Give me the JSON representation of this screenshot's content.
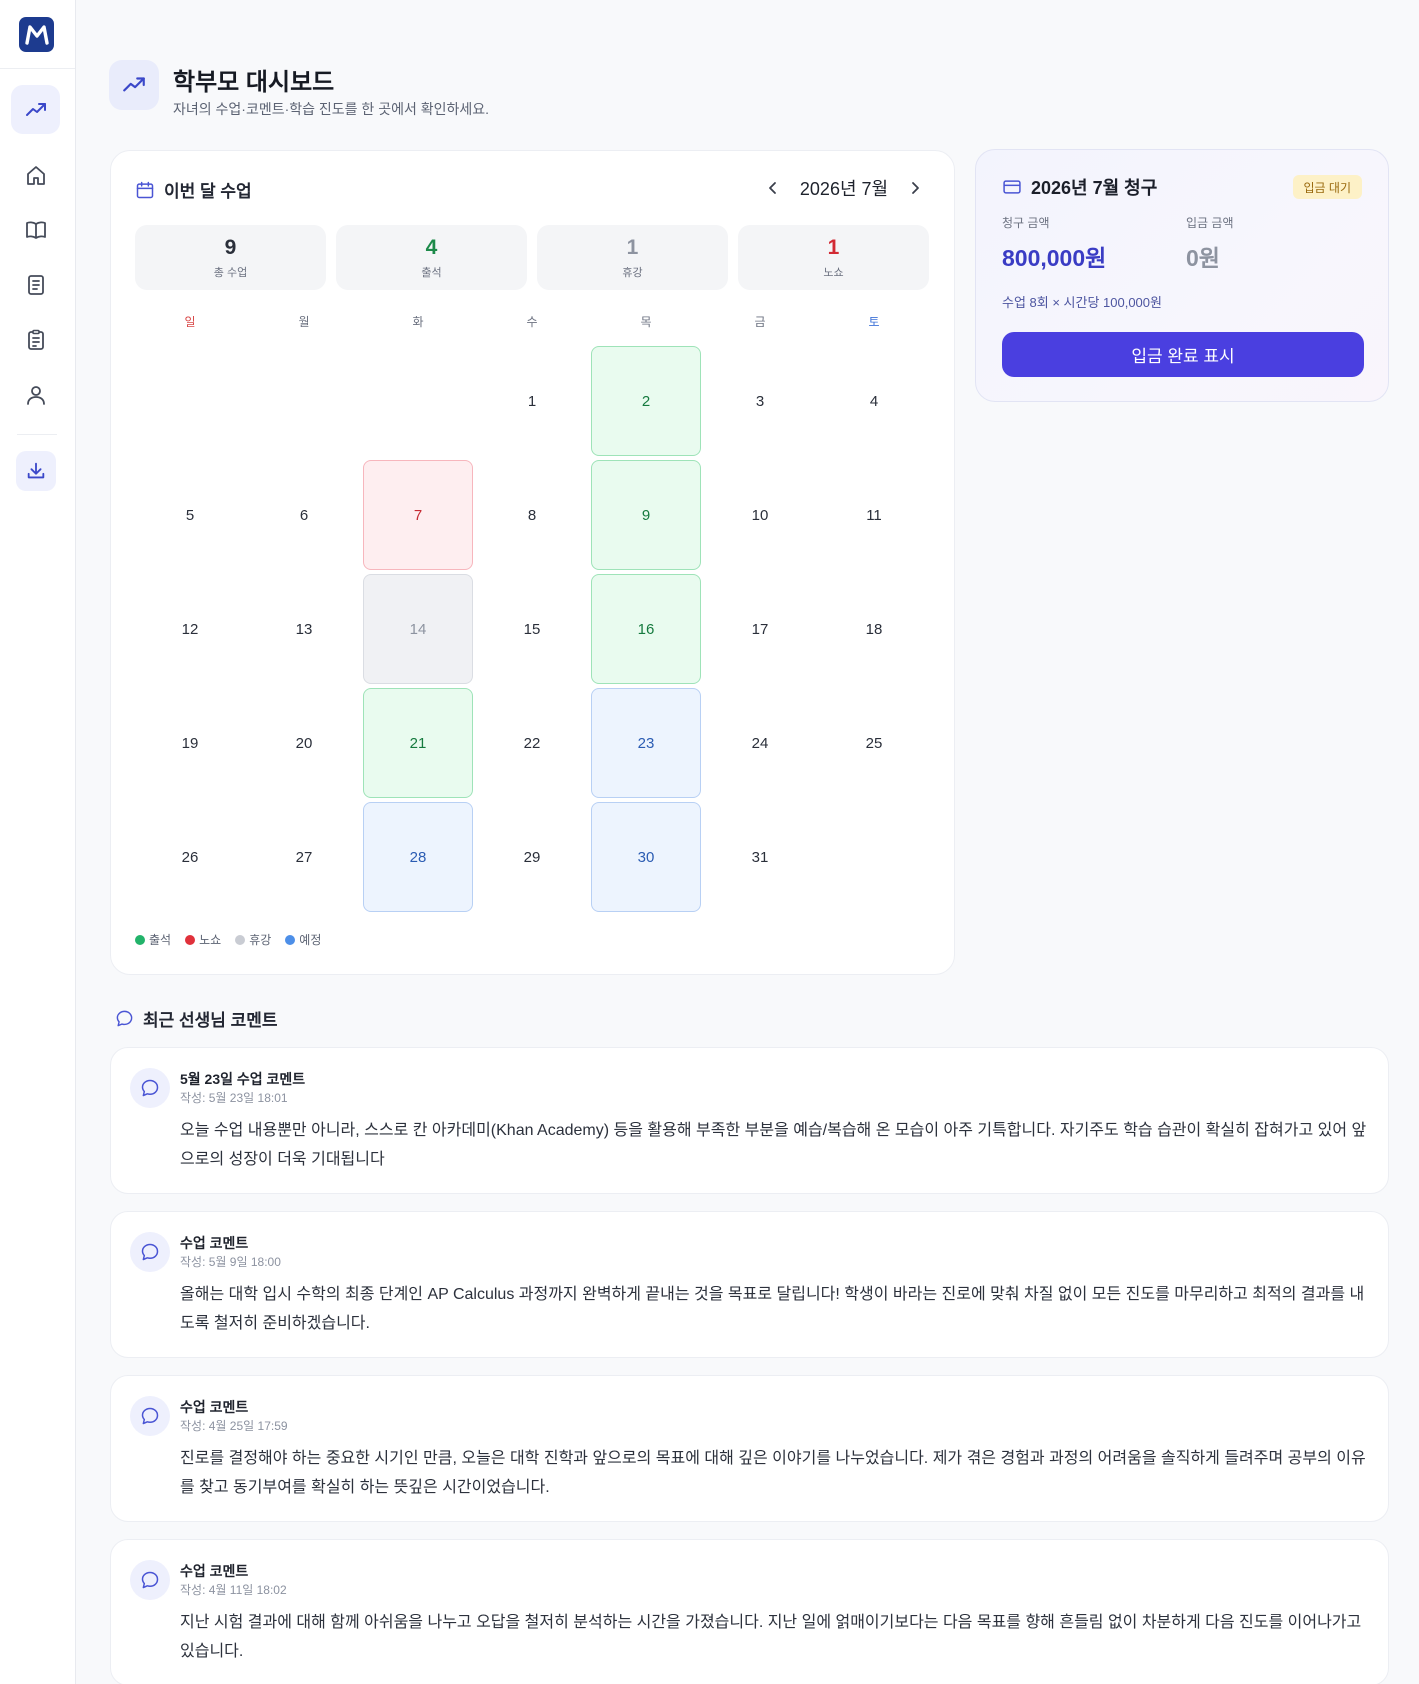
{
  "app": {
    "logo_letter": "M"
  },
  "colors": {
    "accent": "#4a3fe0",
    "attend": "#22b36a",
    "noshow": "#e0313b",
    "break": "#c9ccd3",
    "scheduled": "#4d8fe8"
  },
  "sidebar": {
    "items": [
      {
        "icon": "trend-icon",
        "active": true
      },
      {
        "icon": "home-icon"
      },
      {
        "icon": "book-open-icon"
      },
      {
        "icon": "document-icon"
      },
      {
        "icon": "clipboard-icon"
      },
      {
        "icon": "user-icon"
      }
    ],
    "download_icon": "download-icon"
  },
  "header": {
    "title": "학부모 대시보드",
    "subtitle": "자녀의 수업·코멘트·학습 진도를 한 곳에서 확인하세요."
  },
  "calendar": {
    "title": "이번 달 수업",
    "month_label": "2026년 7월",
    "stats": [
      {
        "value": "9",
        "label": "총 수업",
        "color": "#2a2f3a"
      },
      {
        "value": "4",
        "label": "출석",
        "color": "#1d8a4a"
      },
      {
        "value": "1",
        "label": "휴강",
        "color": "#8d93a0"
      },
      {
        "value": "1",
        "label": "노쇼",
        "color": "#d22a34"
      }
    ],
    "weekdays": [
      "일",
      "월",
      "화",
      "수",
      "목",
      "금",
      "토"
    ],
    "leading_blanks": 3,
    "days": [
      {
        "d": "1",
        "s": ""
      },
      {
        "d": "2",
        "s": "attend"
      },
      {
        "d": "3",
        "s": ""
      },
      {
        "d": "4",
        "s": ""
      },
      {
        "d": "5",
        "s": ""
      },
      {
        "d": "6",
        "s": ""
      },
      {
        "d": "7",
        "s": "noshow"
      },
      {
        "d": "8",
        "s": ""
      },
      {
        "d": "9",
        "s": "attend"
      },
      {
        "d": "10",
        "s": ""
      },
      {
        "d": "11",
        "s": ""
      },
      {
        "d": "12",
        "s": ""
      },
      {
        "d": "13",
        "s": ""
      },
      {
        "d": "14",
        "s": "break"
      },
      {
        "d": "15",
        "s": ""
      },
      {
        "d": "16",
        "s": "attend"
      },
      {
        "d": "17",
        "s": ""
      },
      {
        "d": "18",
        "s": ""
      },
      {
        "d": "19",
        "s": ""
      },
      {
        "d": "20",
        "s": ""
      },
      {
        "d": "21",
        "s": "attend"
      },
      {
        "d": "22",
        "s": ""
      },
      {
        "d": "23",
        "s": "sched"
      },
      {
        "d": "24",
        "s": ""
      },
      {
        "d": "25",
        "s": ""
      },
      {
        "d": "26",
        "s": ""
      },
      {
        "d": "27",
        "s": ""
      },
      {
        "d": "28",
        "s": "sched"
      },
      {
        "d": "29",
        "s": ""
      },
      {
        "d": "30",
        "s": "sched"
      },
      {
        "d": "31",
        "s": ""
      }
    ],
    "legend": [
      {
        "label": "출석",
        "color": "#22b36a"
      },
      {
        "label": "노쇼",
        "color": "#e0313b"
      },
      {
        "label": "휴강",
        "color": "#c9ccd3"
      },
      {
        "label": "예정",
        "color": "#4d8fe8"
      }
    ]
  },
  "billing": {
    "title": "2026년 7월 청구",
    "status_badge": "입금 대기",
    "billed_label": "청구 금액",
    "billed_value": "800,000원",
    "paid_label": "입금 금액",
    "paid_value": "0원",
    "note": "수업 8회 × 시간당 100,000원",
    "button_label": "입금 완료 표시"
  },
  "comments": {
    "section_title": "최근 선생님 코멘트",
    "items": [
      {
        "title": "5월 23일 수업 코멘트",
        "meta": "작성: 5월 23일 18:01",
        "body": "오늘 수업 내용뿐만 아니라, 스스로 칸 아카데미(Khan Academy) 등을 활용해 부족한 부분을 예습/복습해 온 모습이 아주 기특합니다. 자기주도 학습 습관이 확실히 잡혀가고 있어 앞으로의 성장이 더욱 기대됩니다"
      },
      {
        "title": "수업 코멘트",
        "meta": "작성: 5월 9일 18:00",
        "body": "올해는 대학 입시 수학의 최종 단계인 AP Calculus 과정까지 완벽하게 끝내는 것을 목표로 달립니다! 학생이 바라는 진로에 맞춰 차질 없이 모든 진도를 마무리하고 최적의 결과를 내도록 철저히 준비하겠습니다."
      },
      {
        "title": "수업 코멘트",
        "meta": "작성: 4월 25일 17:59",
        "body": "진로를 결정해야 하는 중요한 시기인 만큼, 오늘은 대학 진학과 앞으로의 목표에 대해 깊은 이야기를 나누었습니다. 제가 겪은 경험과 과정의 어려움을 솔직하게 들려주며 공부의 이유를 찾고 동기부여를 확실히 하는 뜻깊은 시간이었습니다."
      },
      {
        "title": "수업 코멘트",
        "meta": "작성: 4월 11일 18:02",
        "body": "지난 시험 결과에 대해 함께 아쉬움을 나누고 오답을 철저히 분석하는 시간을 가졌습니다. 지난 일에 얽매이기보다는 다음 목표를 향해 흔들림 없이 차분하게 다음 진도를 이어나가고 있습니다."
      }
    ]
  }
}
